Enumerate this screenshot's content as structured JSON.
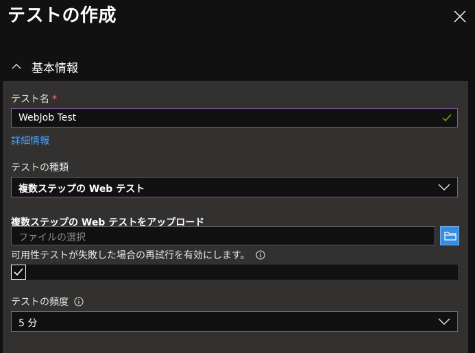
{
  "page": {
    "title": "テストの作成",
    "close_icon": "close-icon"
  },
  "section": {
    "title": "基本情報",
    "expanded": true
  },
  "test_name": {
    "label": "テスト名",
    "required_mark": "*",
    "value": "WebJob Test",
    "valid": true
  },
  "details_link": "詳細情報",
  "test_type": {
    "label": "テストの種類",
    "selected": "複数ステップの Web テスト"
  },
  "upload": {
    "label": "複数ステップの Web テストをアップロード",
    "placeholder": "ファイルの選択",
    "browse_icon": "folder-icon"
  },
  "retry": {
    "label": "可用性テストが失敗した場合の再試行を有効にします。",
    "checked": true
  },
  "frequency": {
    "label": "テストの頻度",
    "selected": "5 分"
  },
  "colors": {
    "accent_border": "#8a56a6",
    "link": "#4da3ff",
    "required": "#f1707b",
    "valid_check": "#6bb700",
    "browse_button": "#3a8dde"
  }
}
